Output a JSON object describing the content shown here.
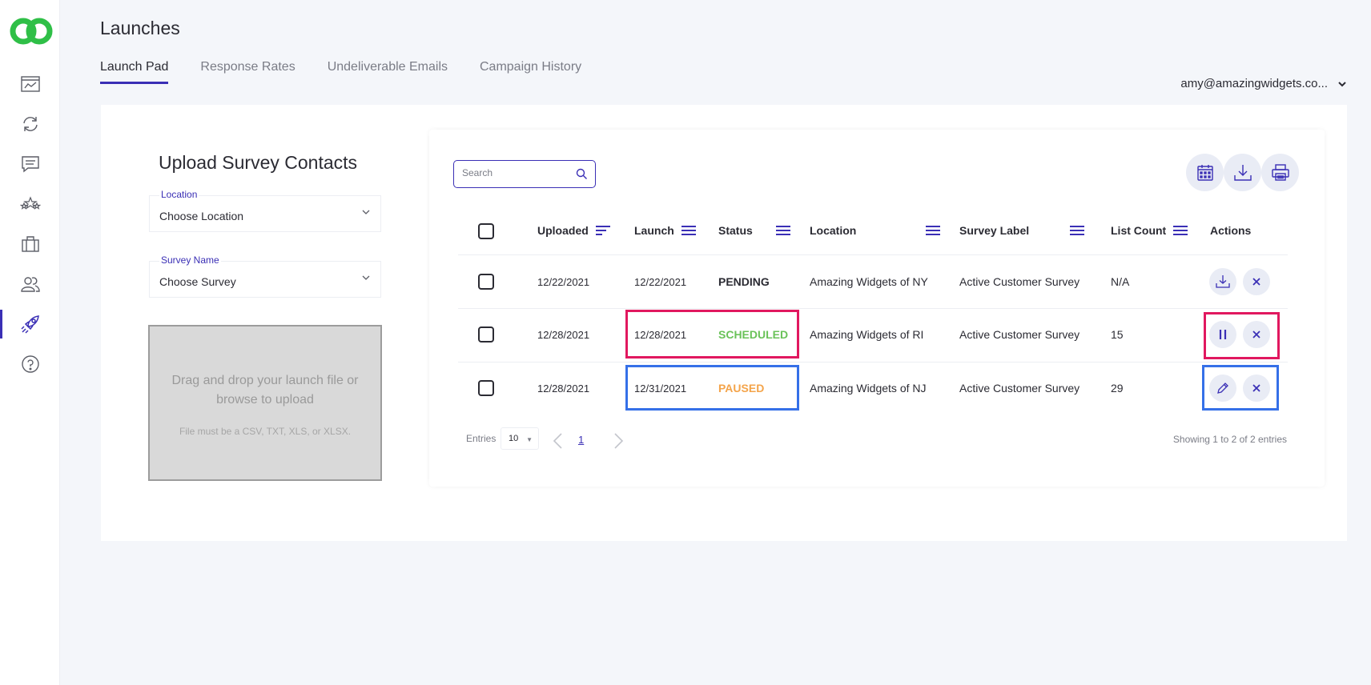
{
  "app": {
    "title": "Launches"
  },
  "nav": [
    {
      "icon": "dashboard-icon"
    },
    {
      "icon": "refresh-icon"
    },
    {
      "icon": "message-icon"
    },
    {
      "icon": "stars-icon"
    },
    {
      "icon": "briefcase-icon"
    },
    {
      "icon": "users-icon"
    },
    {
      "icon": "rocket-icon",
      "active": true
    },
    {
      "icon": "help-icon"
    }
  ],
  "tabs": [
    {
      "label": "Launch Pad",
      "active": true
    },
    {
      "label": "Response Rates"
    },
    {
      "label": "Undeliverable Emails"
    },
    {
      "label": "Campaign History"
    }
  ],
  "user": {
    "email": "amy@amazingwidgets.co..."
  },
  "upload": {
    "title": "Upload Survey Contacts",
    "location": {
      "label": "Location",
      "value": "Choose Location"
    },
    "survey": {
      "label": "Survey Name",
      "value": "Choose Survey"
    },
    "dropzone": {
      "main": "Drag and drop your launch file or browse to upload",
      "sub": "File must be a CSV, TXT, XLS, or XLSX."
    }
  },
  "table": {
    "search_placeholder": "Search",
    "columns": [
      "Uploaded",
      "Launch",
      "Status",
      "Location",
      "Survey Label",
      "List Count",
      "Actions"
    ],
    "rows": [
      {
        "uploaded": "12/22/2021",
        "launch": "12/22/2021",
        "status": "PENDING",
        "location": "Amazing Widgets of NY",
        "survey_label": "Active Customer Survey",
        "list_count": "N/A",
        "actions": [
          "download-icon",
          "close-icon"
        ]
      },
      {
        "uploaded": "12/28/2021",
        "launch": "12/28/2021",
        "status": "SCHEDULED",
        "location": "Amazing Widgets of RI",
        "survey_label": "Active Customer Survey",
        "list_count": "15",
        "actions": [
          "pause-icon",
          "close-icon"
        ]
      },
      {
        "uploaded": "12/28/2021",
        "launch": "12/31/2021",
        "status": "PAUSED",
        "location": "Amazing Widgets of NJ",
        "survey_label": "Active Customer Survey",
        "list_count": "29",
        "actions": [
          "pencil-icon",
          "close-icon"
        ]
      }
    ],
    "status_colors": {
      "PENDING": "#2b2b33",
      "SCHEDULED": "#6ac259",
      "PAUSED": "#f4a44a"
    }
  },
  "pagination": {
    "entries_label": "Entries",
    "entries_value": "10",
    "current_page": "1",
    "showing": "Showing 1 to 2 of 2 entries"
  },
  "colors": {
    "accent": "#3a2fb5",
    "highlight_red": "#e1185f",
    "highlight_blue": "#3570e8",
    "logo_green": "#2fbf47"
  }
}
